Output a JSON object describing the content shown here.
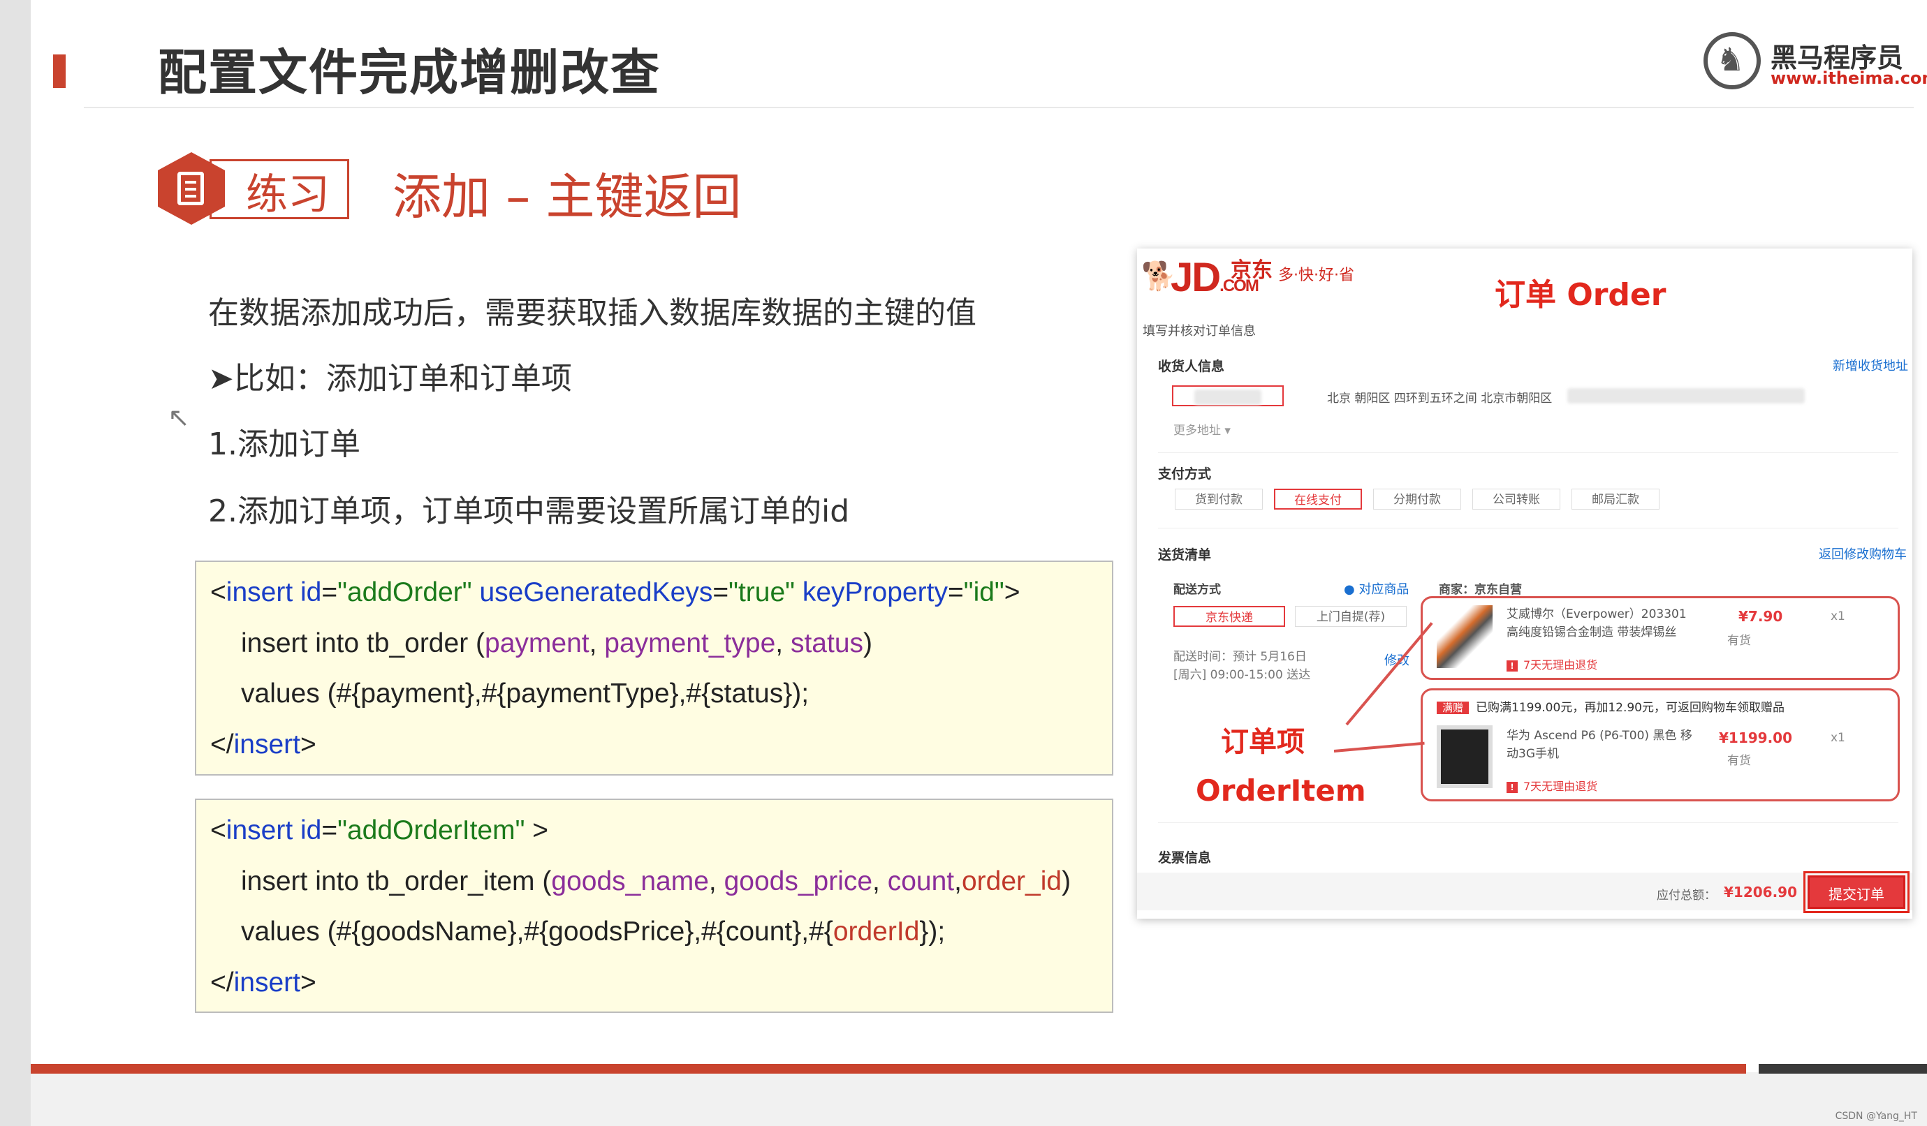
{
  "slide": {
    "title": "配置文件完成增删改查",
    "logo_cn": "黑马程序员",
    "logo_url": "www.itheima.com",
    "badge_label": "练习",
    "subtitle": "添加 – 主键返回"
  },
  "bullets": [
    "在数据添加成功后，需要获取插入数据库数据的主键的值",
    "➤比如：添加订单和订单项",
    "1.添加订单",
    "2.添加订单项，订单项中需要设置所属订单的id"
  ],
  "code1": {
    "l1_open": "<",
    "l1_tag": "insert",
    "l1_a1": "id",
    "l1_v1": "\"addOrder\"",
    "l1_a2": "useGeneratedKeys",
    "l1_v2": "\"true\"",
    "l1_a3": "keyProperty",
    "l1_v3": "\"id\"",
    "l1_close": ">",
    "l2_pre": "insert into tb_order (",
    "l2_c1": "payment",
    "l2_c2": "payment_type",
    "l2_c3": "status",
    "l2_post": ")",
    "l3": "values (#{payment},#{paymentType},#{status});",
    "l4_open": "</",
    "l4_tag": "insert",
    "l4_close": ">"
  },
  "code2": {
    "l1_open": "<",
    "l1_tag": "insert",
    "l1_a1": "id",
    "l1_v1": "\"addOrderItem\"",
    "l1_close": " >",
    "l2_pre": "insert into tb_order_item (",
    "l2_c1": "goods_name",
    "l2_c2": "goods_price",
    "l2_c3": "count",
    "l2_c4": "order_id",
    "l2_post": ")",
    "l3_pre": "values (#{goodsName},#{goodsPrice},#{count},#{",
    "l3_hl": "orderId",
    "l3_post": "});",
    "l4_open": "</",
    "l4_tag": "insert",
    "l4_close": ">"
  },
  "jd": {
    "logo": "JD",
    "logo_com": ".COM",
    "logo_cn": "京东",
    "slogan": "多·快·好·省",
    "annot_order": "订单 Order",
    "sub_title": "填写并核对订单信息",
    "receiver_section": "收货人信息",
    "new_address_link": "新增收货地址",
    "address": "北京 朝阳区 四环到五环之间 北京市朝阳区",
    "more_address": "更多地址 ▾",
    "payment_section": "支付方式",
    "payment_options": [
      "货到付款",
      "在线支付",
      "分期付款",
      "公司转账",
      "邮局汇款"
    ],
    "goods_section": "送货清单",
    "back_cart_link": "返回修改购物车",
    "delivery_label": "配送方式",
    "matched_goods": "对应商品",
    "seller": "商家：京东自营",
    "delivery_options": [
      "京东快递",
      "上门自提(荐)"
    ],
    "delivery_time": "配送时间：预计 5月16日[周六] 09:00-15:00 送达",
    "modify_link": "修改",
    "items": [
      {
        "name": "艾威博尔（Everpower）203301 高纯度铅锡合金制造 带装焊锡丝",
        "price": "¥7.90",
        "qty": "x1",
        "stock": "有货",
        "return_note": "7天无理由退货"
      },
      {
        "name": "华为 Ascend P6 (P6-T00) 黑色 移动3G手机",
        "price": "¥1199.00",
        "qty": "x1",
        "stock": "有货",
        "return_note": "7天无理由退货"
      }
    ],
    "promo_tag": "满赠",
    "promo_text": "已购满1199.00元，再加12.90元，可返回购物车领取赠品",
    "annot_item_cn": "订单项",
    "annot_item_en": "OrderItem",
    "invoice_section": "发票信息",
    "total_label": "应付总额：",
    "total_value": "¥1206.90",
    "submit_label": "提交订单"
  },
  "watermark": "CSDN @Yang_HT",
  "colors": {
    "accent": "#c9432e",
    "jd_red": "#e4393c",
    "code_bg": "#fffde2"
  }
}
